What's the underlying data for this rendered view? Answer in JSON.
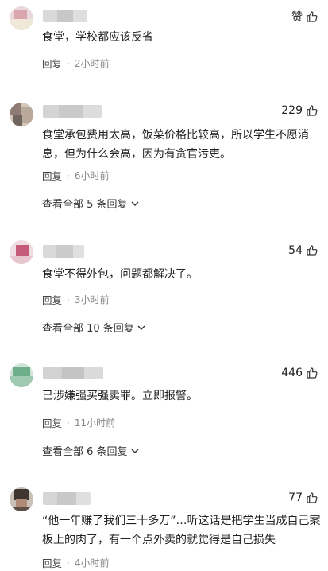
{
  "comments": [
    {
      "like_label": "赞",
      "text": "食堂，学校都应该反省",
      "reply_label": "回复",
      "separator": "·",
      "time": "2小时前",
      "view_all": null
    },
    {
      "like_label": "229",
      "text": "食堂承包费用太高，饭菜价格比较高，所以学生不愿消息，但为什么会高，因为有贪官污吏。",
      "reply_label": "回复",
      "separator": "·",
      "time": "6小时前",
      "view_all": "查看全部 5 条回复"
    },
    {
      "like_label": "54",
      "text": "食堂不得外包，问题都解决了。",
      "reply_label": "回复",
      "separator": "·",
      "time": "3小时前",
      "view_all": "查看全部 10 条回复"
    },
    {
      "like_label": "446",
      "text": "已涉嫌强买强卖罪。立即报警。",
      "reply_label": "回复",
      "separator": "·",
      "time": "11小时前",
      "view_all": "查看全部 6 条回复"
    },
    {
      "like_label": "77",
      "text": "“他一年赚了我们三十多万”…听这话是把学生当成自己案板上的肉了，有一个点外卖的就觉得是自己损失",
      "reply_label": "回复",
      "separator": "·",
      "time": "4小时前",
      "view_all": null
    }
  ],
  "icons": {
    "like": "thumbs-up-icon",
    "expand": "chevron-down-icon"
  }
}
